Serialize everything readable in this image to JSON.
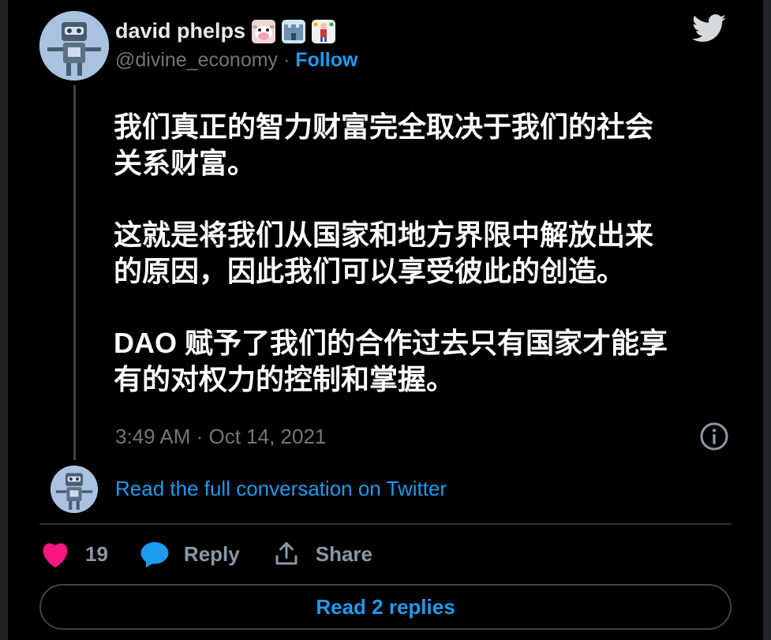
{
  "author": {
    "name": "david phelps",
    "handle": "@divine_economy",
    "separator": " · ",
    "follow_label": "Follow",
    "emojis": [
      "cow-face",
      "castle",
      "juggler"
    ]
  },
  "tweet": {
    "paragraphs": [
      "我们真正的智力财富完全取决于我们的社会\n关系财富。",
      "这就是将我们从国家和地方界限中解放出来\n的原因，因此我们可以享受彼此的创造。",
      "DAO 赋予了我们的合作过去只有国家才能享\n有的对权力的控制和掌握。"
    ],
    "timestamp": "3:49 AM · Oct 14, 2021"
  },
  "conversation": {
    "link_label": "Read the full conversation on Twitter"
  },
  "actions": {
    "like_count": "19",
    "reply_label": "Reply",
    "share_label": "Share"
  },
  "footer": {
    "read_replies_label": "Read 2 replies"
  },
  "colors": {
    "accent": "#1d9bf0",
    "like": "#f91880",
    "background": "#000000",
    "muted": "#71767b"
  }
}
